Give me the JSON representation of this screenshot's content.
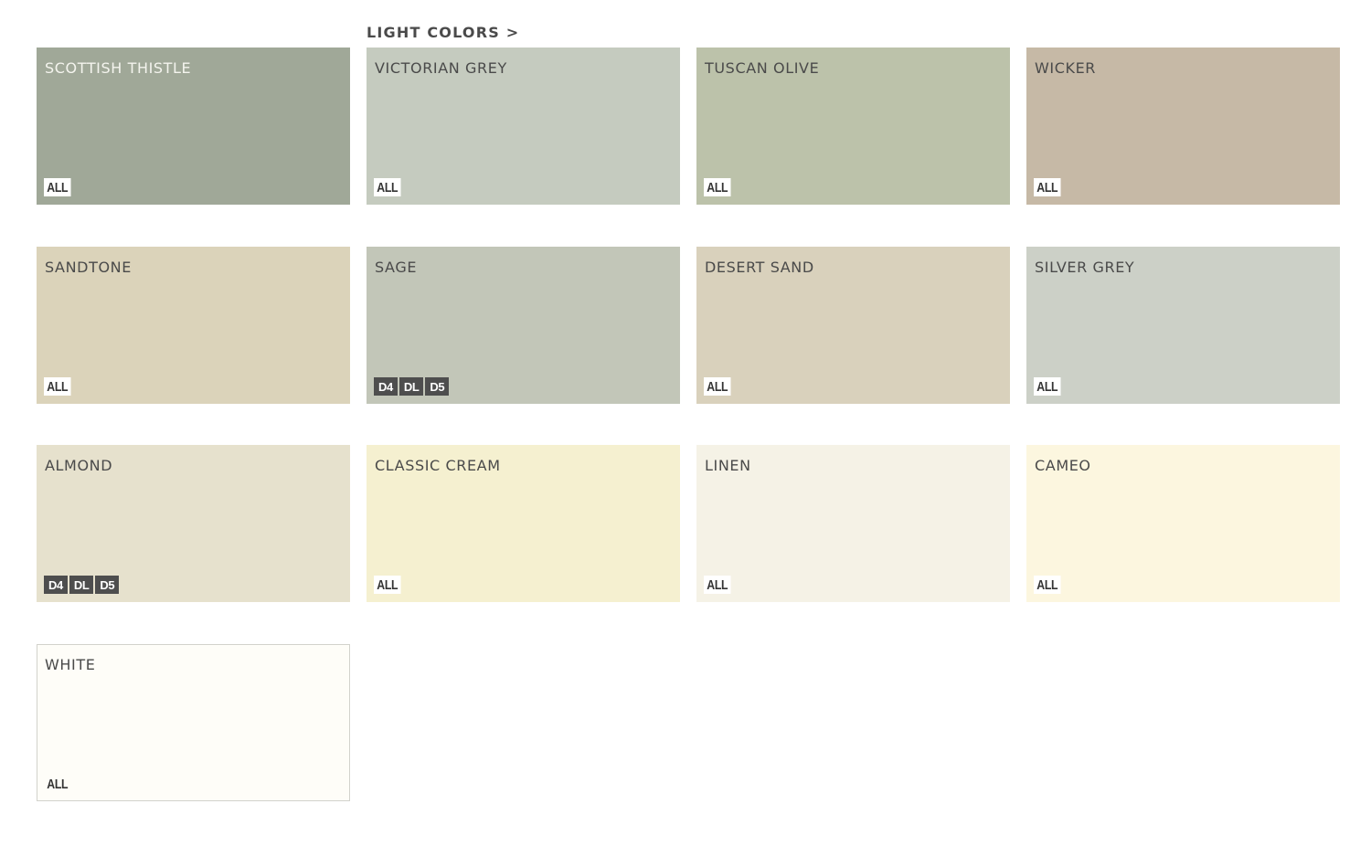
{
  "header": {
    "title": "LIGHT COLORS >"
  },
  "swatches": [
    {
      "name": "SCOTTISH THISTLE",
      "color": "#a0a898",
      "text_color": "#f4f4ee",
      "badges": [
        "ALL"
      ],
      "badge_style": "light"
    },
    {
      "name": "VICTORIAN GREY",
      "color": "#c5cbbf",
      "text_color": "#4a4a4a",
      "badges": [
        "ALL"
      ],
      "badge_style": "light"
    },
    {
      "name": "TUSCAN OLIVE",
      "color": "#bcc2aa",
      "text_color": "#4a4a4a",
      "badges": [
        "ALL"
      ],
      "badge_style": "light"
    },
    {
      "name": "WICKER",
      "color": "#c6b9a6",
      "text_color": "#4a4a4a",
      "badges": [
        "ALL"
      ],
      "badge_style": "light"
    },
    {
      "name": "SANDTONE",
      "color": "#dbd3ba",
      "text_color": "#4a4a4a",
      "badges": [
        "ALL"
      ],
      "badge_style": "light"
    },
    {
      "name": "SAGE",
      "color": "#c2c6b8",
      "text_color": "#4a4a4a",
      "badges": [
        "D4",
        "DL",
        "D5"
      ],
      "badge_style": "dark"
    },
    {
      "name": "DESERT SAND",
      "color": "#d9d1bc",
      "text_color": "#4a4a4a",
      "badges": [
        "ALL"
      ],
      "badge_style": "light"
    },
    {
      "name": "SILVER GREY",
      "color": "#ccd0c7",
      "text_color": "#4a4a4a",
      "badges": [
        "ALL"
      ],
      "badge_style": "light"
    },
    {
      "name": "ALMOND",
      "color": "#e6e1cd",
      "text_color": "#4a4a4a",
      "badges": [
        "D4",
        "DL",
        "D5"
      ],
      "badge_style": "dark"
    },
    {
      "name": "CLASSIC CREAM",
      "color": "#f5f0d0",
      "text_color": "#4a4a4a",
      "badges": [
        "ALL"
      ],
      "badge_style": "light"
    },
    {
      "name": "LINEN",
      "color": "#f5f2e6",
      "text_color": "#4a4a4a",
      "badges": [
        "ALL"
      ],
      "badge_style": "light"
    },
    {
      "name": "CAMEO",
      "color": "#fcf6df",
      "text_color": "#4a4a4a",
      "badges": [
        "ALL"
      ],
      "badge_style": "light"
    },
    {
      "name": "WHITE",
      "color": "#fefdf8",
      "text_color": "#4a4a4a",
      "badges": [
        "ALL"
      ],
      "badge_style": "light",
      "bordered": true
    }
  ]
}
